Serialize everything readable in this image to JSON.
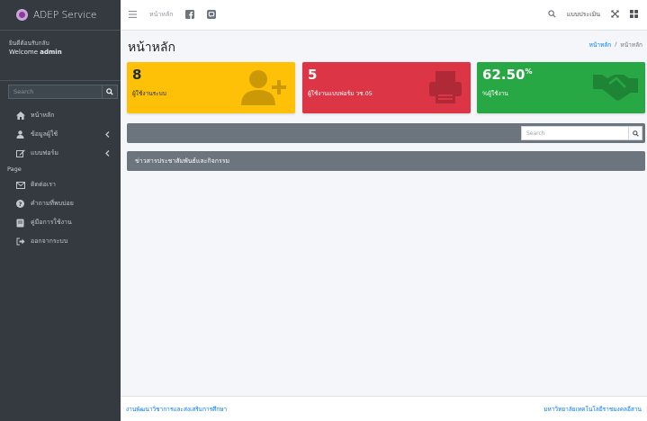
{
  "brand": {
    "name": "ADEP Service"
  },
  "user": {
    "greeting": "ยินดีต้อนรับกลับ",
    "welcome_prefix": "Welcome",
    "username": "admin"
  },
  "sidebar": {
    "search_placeholder": "Search",
    "items": [
      {
        "label": "หน้าหลัก",
        "icon": "home-icon"
      },
      {
        "label": "ข้อมูลผู้ใช้",
        "icon": "user-icon",
        "has_submenu": true
      },
      {
        "label": "แบบฟอร์ม",
        "icon": "edit-icon",
        "has_submenu": true
      }
    ],
    "section_header": "Page",
    "page_items": [
      {
        "label": "ติดต่อเรา",
        "icon": "envelope-icon"
      },
      {
        "label": "คำถามที่พบบ่อย",
        "icon": "question-icon"
      },
      {
        "label": "คู่มือการใช้งาน",
        "icon": "book-icon"
      },
      {
        "label": "ออกจากระบบ",
        "icon": "sign-out-icon"
      }
    ]
  },
  "topbar": {
    "home_link": "หน้าหลัก",
    "mode_label": "แบบประเมิน"
  },
  "page": {
    "title": "หน้าหลัก",
    "breadcrumb": [
      "หน้าหลัก",
      "หน้าหลัก"
    ],
    "breadcrumb_sep": "/"
  },
  "stats": [
    {
      "value": "8",
      "label": "ผู้ใช้งานระบบ",
      "color": "#ffc107",
      "icon": "user-plus-icon"
    },
    {
      "value": "5",
      "label": "ผู้ใช้งานแบบฟอร์ม วช.05",
      "color": "#dc3545",
      "icon": "printer-icon"
    },
    {
      "value": "62.50",
      "suffix": "%",
      "label": "%ผู้ใช้งาน",
      "color": "#28a745",
      "icon": "handshake-icon"
    }
  ],
  "search_card": {
    "placeholder": "Search"
  },
  "news_card": {
    "title": "ข่าวสารประชาสัมพันธ์และกิจกรรม"
  },
  "footer": {
    "left": "งานพัฒนาวิชาการและส่งเสริมการศึกษา",
    "right": "มหาวิทยาลัยเทคโนโลยีราชมงคลอีสาน"
  }
}
